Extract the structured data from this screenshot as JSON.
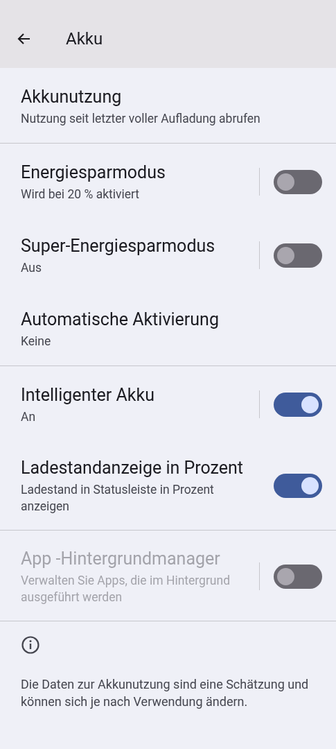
{
  "app_bar": {
    "title": "Akku"
  },
  "sections": [
    {
      "items": [
        {
          "kind": "plain",
          "title": "Akkunutzung",
          "summary": "Nutzung seit letzter voller Aufladung abrufen",
          "disabled": false
        }
      ]
    },
    {
      "items": [
        {
          "kind": "split_switch",
          "title": "Energiesparmodus",
          "summary": "Wird bei 20 % aktiviert",
          "on": false,
          "disabled": false
        },
        {
          "kind": "split_switch",
          "title": "Super-Energiesparmodus",
          "summary": "Aus",
          "on": false,
          "disabled": false
        },
        {
          "kind": "plain",
          "title": "Automatische Aktivierung",
          "summary": "Keine",
          "disabled": false
        }
      ]
    },
    {
      "items": [
        {
          "kind": "split_switch",
          "title": "Intelligenter Akku",
          "summary": "An",
          "on": true,
          "disabled": false
        },
        {
          "kind": "switch",
          "title": "Ladestandanzeige in Prozent",
          "summary": "Ladestand in Statusleiste in Prozent anzeigen",
          "on": true,
          "disabled": false
        }
      ]
    },
    {
      "items": [
        {
          "kind": "split_switch",
          "title": "App -Hintergrundmanager",
          "summary": "Verwalten Sie Apps, die im Hintergrund ausgeführt werden",
          "on": false,
          "disabled": true
        }
      ]
    }
  ],
  "footer": {
    "text": "Die Daten zur Akkunutzung sind eine Schätzung und können sich je nach Verwendung ändern."
  }
}
